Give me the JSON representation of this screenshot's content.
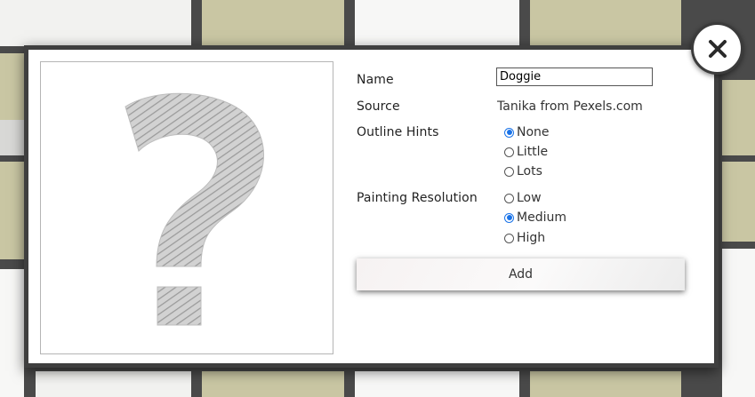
{
  "dialog": {
    "close_icon": "close-icon",
    "preview_icon": "question-mark-icon",
    "fields": {
      "name_label": "Name",
      "name_value": "Doggie",
      "source_label": "Source",
      "source_value": "Tanika from Pexels.com",
      "outline_hints_label": "Outline Hints",
      "outline_hints_options": [
        "None",
        "Little",
        "Lots"
      ],
      "outline_hints_selected": "None",
      "resolution_label": "Painting Resolution",
      "resolution_options": [
        "Low",
        "Medium",
        "High"
      ],
      "resolution_selected": "Medium"
    },
    "add_label": "Add"
  },
  "colors": {
    "accent": "#1a73e8",
    "modal_border": "#3f3f3f",
    "backdrop": "#4a4a4a"
  }
}
